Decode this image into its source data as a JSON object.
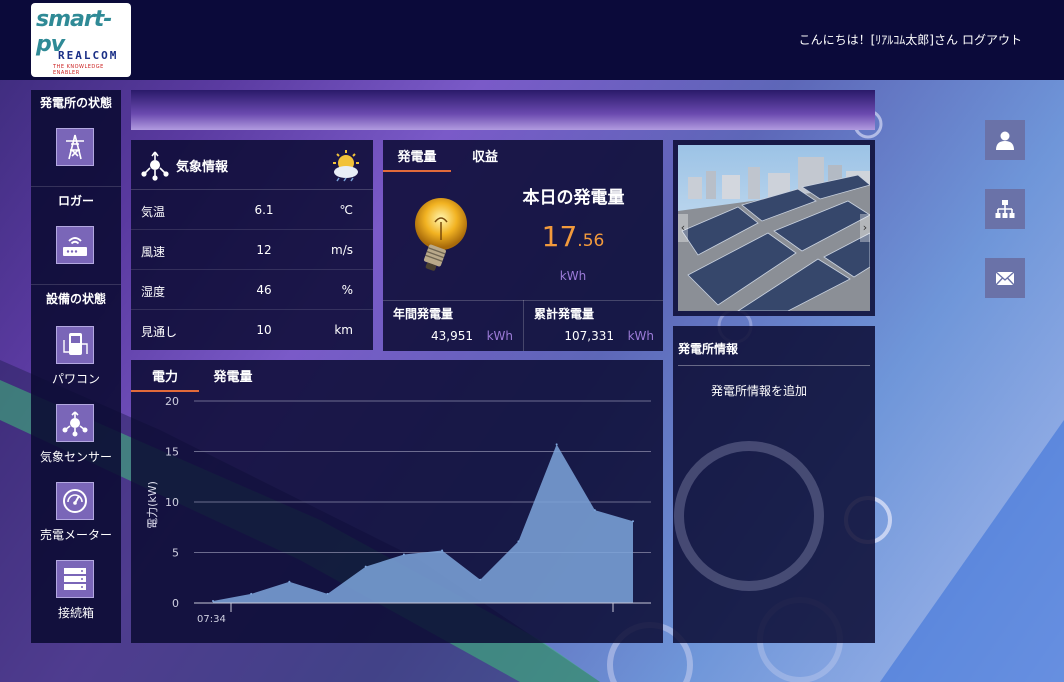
{
  "logo": {
    "line1": "smart-pv",
    "line2": "REALCOM",
    "line3": "THE KNOWLEDGE ENABLER"
  },
  "header": {
    "greeting": "こんにちは！[ﾘｱﾙｺﾑ太郎]さん",
    "logout": "ログアウト"
  },
  "sidebar": {
    "section_status": "発電所の状態",
    "section_logger": "ロガー",
    "section_equipment": "設備の状態",
    "items": [
      {
        "label": "パワコン",
        "icon": "power-conditioner-icon"
      },
      {
        "label": "気象センサー",
        "icon": "weather-sensor-icon"
      },
      {
        "label": "売電メーター",
        "icon": "meter-gauge-icon"
      },
      {
        "label": "接続箱",
        "icon": "junction-box-icon"
      }
    ]
  },
  "weather": {
    "title": "気象情報",
    "rows": [
      {
        "name": "気温",
        "value": "6.1",
        "unit": "℃"
      },
      {
        "name": "風速",
        "value": "12",
        "unit": "m/s"
      },
      {
        "name": "湿度",
        "value": "46",
        "unit": "%"
      },
      {
        "name": "見通し",
        "value": "10",
        "unit": "km"
      }
    ]
  },
  "generation": {
    "tabs": [
      "発電量",
      "収益"
    ],
    "title": "本日の発電量",
    "value_int": "17",
    "value_dec": ".56",
    "unit": "kWh",
    "annual_label": "年間発電量",
    "annual_value": "43,951",
    "annual_unit": "kWh",
    "total_label": "累計発電量",
    "total_value": "107,331",
    "total_unit": "kWh"
  },
  "plant_info": {
    "title": "発電所情報",
    "add_label": "発電所情報を追加"
  },
  "photo": {
    "prev": "‹",
    "next": "›"
  },
  "chart_tabs": [
    "電力",
    "発電量"
  ],
  "chart_data": {
    "type": "area",
    "ylabel": "電力(kW)",
    "ylim": [
      0,
      20
    ],
    "yticks": [
      "0",
      "5",
      "10",
      "15",
      "20"
    ],
    "xlabel_start": "07:34",
    "x": [
      0,
      1,
      2,
      3,
      4,
      5,
      6,
      7,
      8,
      9,
      10,
      11
    ],
    "values": [
      0.2,
      0.9,
      2.1,
      0.9,
      3.6,
      4.8,
      5.2,
      2.3,
      6.1,
      15.7,
      9.2,
      8.1
    ],
    "color": "#7ea6dc",
    "grid": true
  },
  "colors": {
    "accent": "#e26a3a",
    "value": "#f29a3c",
    "unit": "#9c7bd8"
  }
}
